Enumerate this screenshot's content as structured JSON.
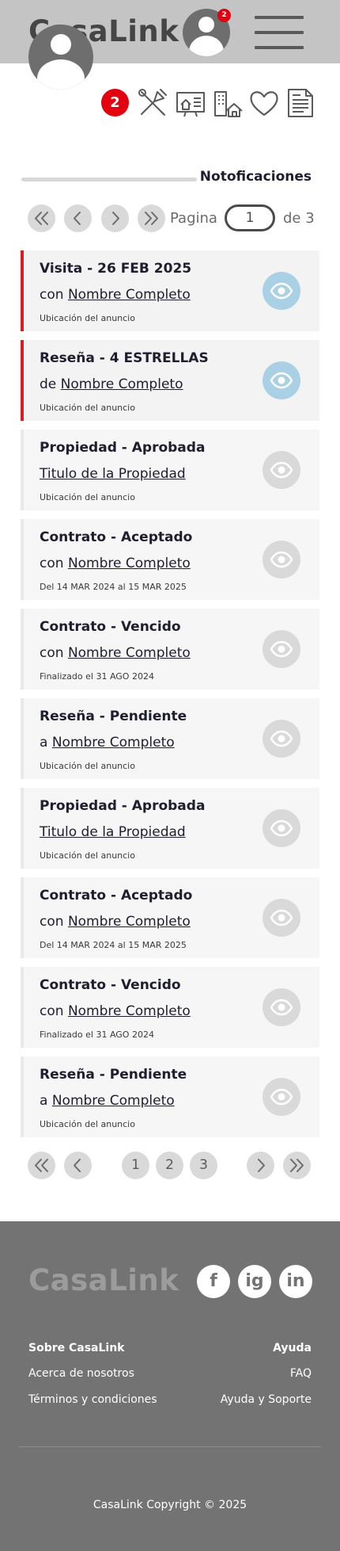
{
  "header": {
    "logo": "CasaLink",
    "avatar_badge": "2"
  },
  "profile": {
    "notification_badge": "2",
    "icons": [
      "tools-icon",
      "property-board-icon",
      "buildings-house-icon",
      "heart-icon",
      "document-icon"
    ]
  },
  "section": {
    "title": "Notoficaciones"
  },
  "pager": {
    "page_label": "Pagina",
    "current_page": "1",
    "total_label": "de 3",
    "pages": [
      "1",
      "2",
      "3"
    ]
  },
  "notifications": [
    {
      "title": "Visita - 26 FEB 2025",
      "prefix": "con",
      "link": "Nombre Completo",
      "meta": "Ubicación del anuncio",
      "unread": true
    },
    {
      "title": "Reseña - 4 ESTRELLAS",
      "prefix": "de",
      "link": "Nombre Completo",
      "meta": "Ubicación del anuncio",
      "unread": true
    },
    {
      "title": "Propiedad - Aprobada",
      "prefix": "",
      "link": "Titulo de la Propiedad",
      "meta": "Ubicación del anuncio",
      "unread": false
    },
    {
      "title": "Contrato - Aceptado",
      "prefix": "con",
      "link": "Nombre Completo",
      "meta": "Del 14 MAR 2024 al 15 MAR 2025",
      "unread": false
    },
    {
      "title": "Contrato - Vencido",
      "prefix": "con",
      "link": "Nombre Completo",
      "meta": "Finalizado el 31 AGO 2024",
      "unread": false
    },
    {
      "title": "Reseña - Pendiente",
      "prefix": "a",
      "link": "Nombre Completo",
      "meta": "Ubicación del anuncio",
      "unread": false
    },
    {
      "title": "Propiedad - Aprobada",
      "prefix": "",
      "link": "Titulo de la Propiedad",
      "meta": "Ubicación del anuncio",
      "unread": false
    },
    {
      "title": "Contrato - Aceptado",
      "prefix": "con",
      "link": "Nombre Completo",
      "meta": "Del 14 MAR 2024 al 15 MAR 2025",
      "unread": false
    },
    {
      "title": "Contrato - Vencido",
      "prefix": "con",
      "link": "Nombre Completo",
      "meta": "Finalizado el 31 AGO 2024",
      "unread": false
    },
    {
      "title": "Reseña - Pendiente",
      "prefix": "a",
      "link": "Nombre Completo",
      "meta": "Ubicación del anuncio",
      "unread": false
    }
  ],
  "footer": {
    "logo": "CasaLink",
    "social": [
      "f",
      "ig",
      "in"
    ],
    "col_left_heading": "Sobre CasaLink",
    "col_left_links": [
      "Acerca de nosotros",
      "Términos y condiciones"
    ],
    "col_right_heading": "Ayuda",
    "col_right_links": [
      "FAQ",
      "Ayuda y Soporte"
    ],
    "copyright": "CasaLink Copyright © 2025"
  },
  "colors": {
    "accent_unread": "#d81d23",
    "eye_unread": "#a9d0e4",
    "badge": "#e3000f",
    "header_bg": "#c4c4c4",
    "footer_bg": "#737373"
  }
}
